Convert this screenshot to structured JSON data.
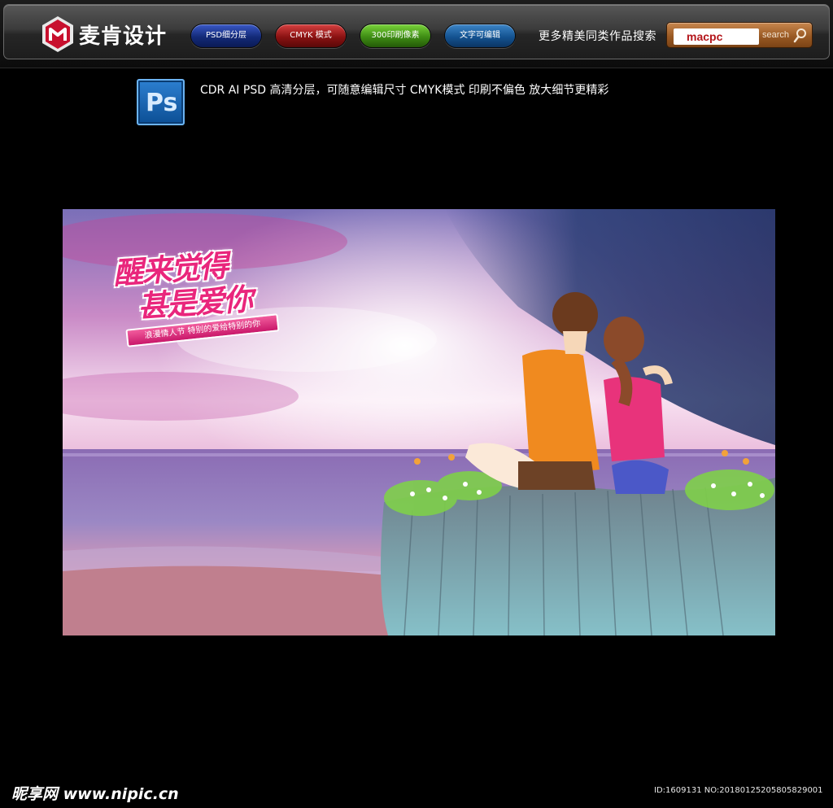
{
  "header": {
    "logo_text": "麦肯设计",
    "badges": [
      {
        "label": "PSD细分层"
      },
      {
        "label": "CMYK 模式"
      },
      {
        "label": "300印刷像素"
      },
      {
        "label": "文字可编辑"
      }
    ],
    "more_link": "更多精美同类作品搜索",
    "search": {
      "value": "macpc",
      "button_label": "search"
    }
  },
  "info": {
    "ps_label": "Ps",
    "text": "CDR  AI   PSD 高清分层，可随意编辑尺寸  CMYK模式  印刷不偏色  放大细节更精彩"
  },
  "artwork": {
    "title_line1": "醒来觉得",
    "title_line2": "甚是爱你",
    "ribbon_text": "浪漫情人节 特别的爱给特别的你"
  },
  "footer": {
    "site_logo": "昵享网 www.nipic.cn",
    "image_id": "ID:1609131 NO:20180125205805829001"
  },
  "colors": {
    "title_pink": "#e9267c",
    "search_orange": "#9a5a24"
  }
}
